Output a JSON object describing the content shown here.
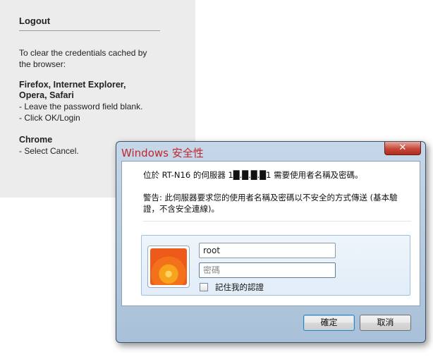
{
  "logout_panel": {
    "title": "Logout",
    "intro_line1": "To clear the credentials cached by",
    "intro_line2": "the browser:",
    "firefox_heading1": "Firefox, Internet Explorer,",
    "firefox_heading2": "Opera, Safari",
    "firefox_step1": "- Leave the password field blank.",
    "firefox_step2": "- Click OK/Login",
    "chrome_heading": "Chrome",
    "chrome_step1": "- Select Cancel."
  },
  "dialog": {
    "title": "Windows 安全性",
    "close_label": "✕",
    "message1": "位於 RT-N16 的伺服器 1█.█.█.█1 需要使用者名稱及密碼。",
    "message2": "警告: 此伺服器要求您的使用者名稱及密碼以不安全的方式傳送 (基本驗證，不含安全連線)。",
    "username_value": "root",
    "password_placeholder": "密碼",
    "remember_label": "記住我的認證",
    "ok_label": "確定",
    "cancel_label": "取消"
  },
  "colors": {
    "title_red": "#c1262c",
    "panel_gray": "#ececec",
    "dialog_blue": "#b9cde2"
  }
}
